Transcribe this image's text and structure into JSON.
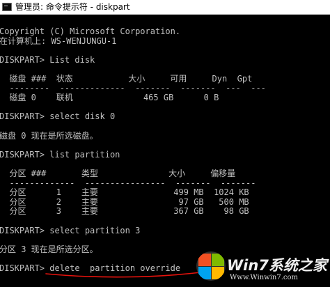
{
  "window": {
    "title": "管理员: 命令提示符 - diskpart"
  },
  "console": {
    "lines": [
      "Copyright (C) Microsoft Corporation.",
      "在计算机上: WS-WENJUNGU-1",
      "",
      "DISKPART> List disk",
      "",
      "  磁盘 ###  状态           大小     可用     Dyn  Gpt",
      "  --------  -------------  -------  -------  ---  ---",
      "  磁盘 0    联机              465 GB      0 B",
      "",
      "DISKPART> select disk 0",
      "",
      "磁盘 0 现在是所选磁盘。",
      "",
      "DISKPART> list partition",
      "",
      "  分区 ###       类型              大小     偏移量",
      "  -------------  ----------------  -------  -------",
      "  分区      1    主要               499 MB  1024 KB",
      "  分区      2    主要                97 GB   500 MB",
      "  分区      3    主要               367 GB    98 GB",
      "",
      "DISKPART> select partition 3",
      "",
      "分区 3 现在是所选分区。",
      "",
      "DISKPART> delete  partition override"
    ]
  },
  "annotation": {
    "color": "#e8120c"
  },
  "watermark": {
    "brand": "Win7系统之家",
    "url": "Www.Winwin7.com"
  }
}
